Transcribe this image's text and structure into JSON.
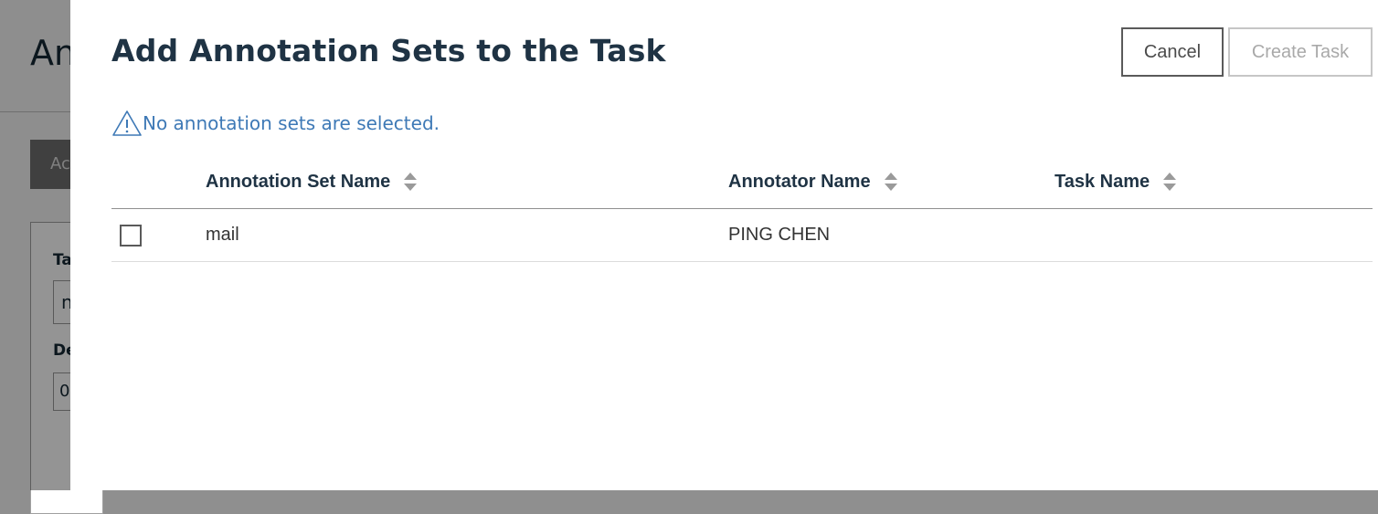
{
  "background": {
    "page_title": "An",
    "action_button": "Ac",
    "field1_label": "Ta",
    "field1_value": "n",
    "field2_label": "De",
    "field2_value": "0"
  },
  "modal": {
    "title": "Add Annotation Sets to the Task",
    "cancel_label": "Cancel",
    "create_label": "Create Task",
    "warning_text": "No annotation sets are selected.",
    "warning_icon": "warning-triangle-icon",
    "table": {
      "columns": [
        "Annotation Set Name",
        "Annotator Name",
        "Task Name"
      ],
      "rows": [
        {
          "checked": false,
          "set_name": "mail",
          "annotator": "PING CHEN",
          "task": ""
        }
      ]
    }
  },
  "colors": {
    "title": "#1f3344",
    "warning": "#3e79b6",
    "cancel_border": "#5a5a5a",
    "create_disabled": "#a9a9a9"
  }
}
